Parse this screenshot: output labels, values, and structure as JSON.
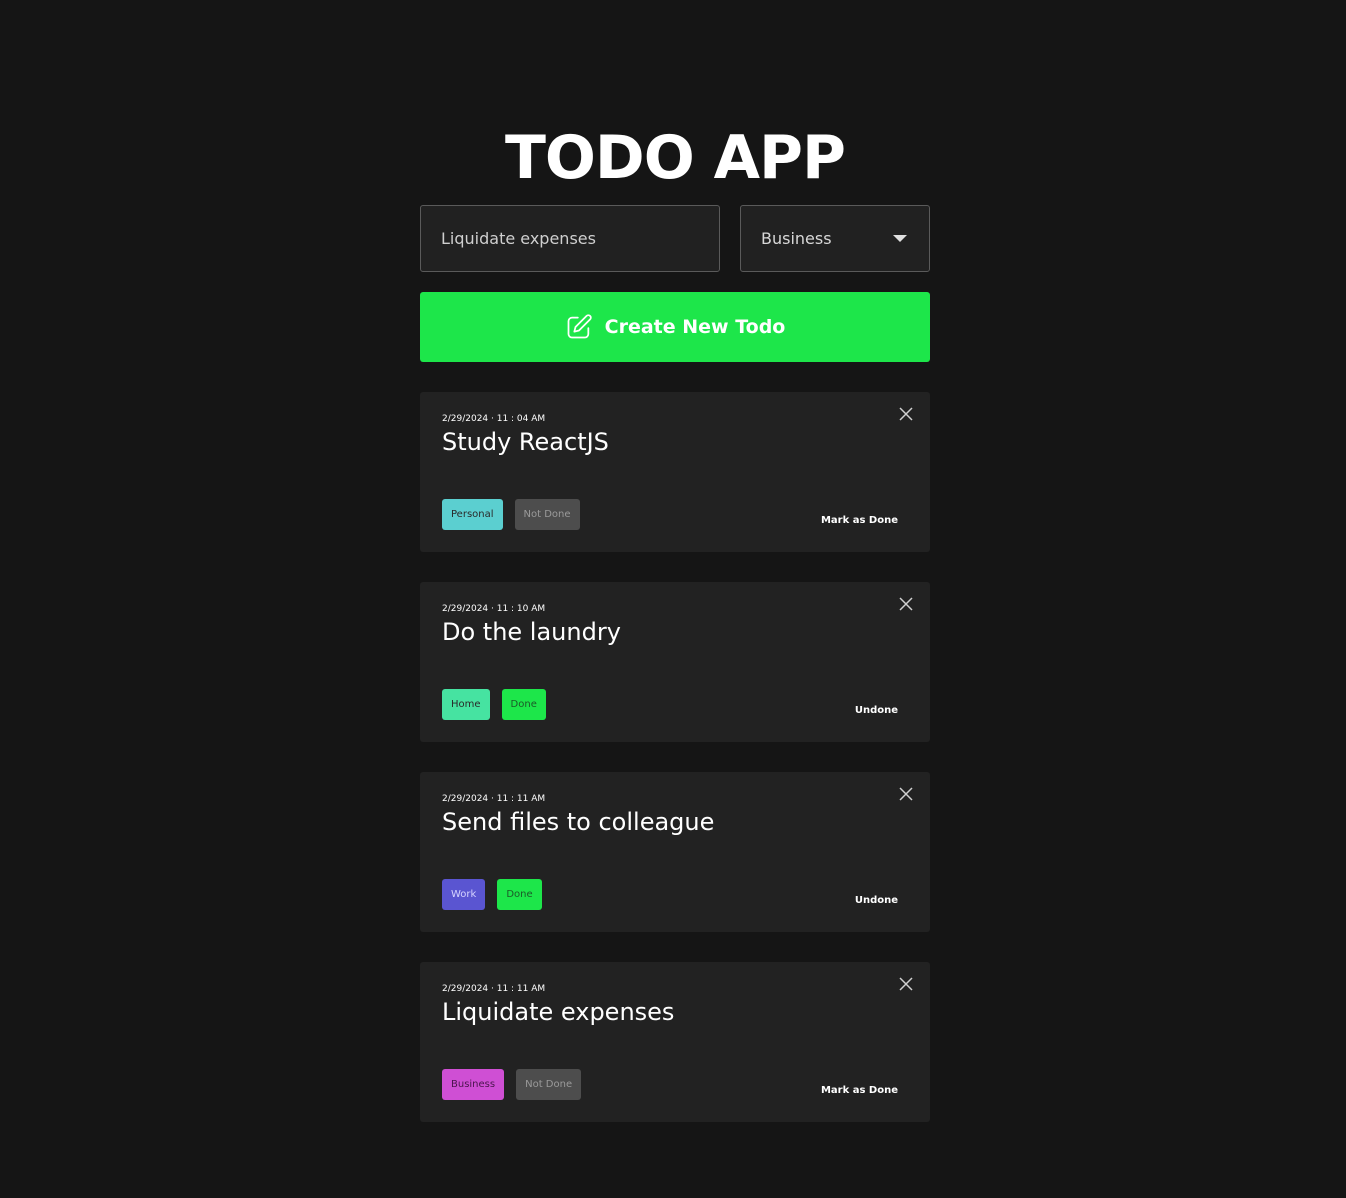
{
  "app": {
    "title": "TODO APP"
  },
  "form": {
    "input_value": "Liquidate expenses",
    "category_selected": "Business",
    "create_label": "Create New Todo",
    "create_icon": "pencil-square-icon"
  },
  "todos": [
    {
      "date": "2/29/2024 · 11 : 04 AM",
      "title": "Study ReactJS",
      "category": "Personal",
      "category_color": "#5bcfd0",
      "status": "Not Done",
      "action": "Mark as Done"
    },
    {
      "date": "2/29/2024 · 11 : 10 AM",
      "title": "Do the laundry",
      "category": "Home",
      "category_color": "#46e3a1",
      "status": "Done",
      "action": "Undone"
    },
    {
      "date": "2/29/2024 · 11 : 11 AM",
      "title": "Send files to colleague",
      "category": "Work",
      "category_color": "#5a55d1",
      "status": "Done",
      "action": "Undone"
    },
    {
      "date": "2/29/2024 · 11 : 11 AM",
      "title": "Liquidate expenses",
      "category": "Business",
      "category_color": "#cf4fd4",
      "status": "Not Done",
      "action": "Mark as Done"
    }
  ],
  "colors": {
    "background": "#151515",
    "card": "#222222",
    "accent_green": "#1de64a",
    "not_done": "#4d4d4d"
  }
}
